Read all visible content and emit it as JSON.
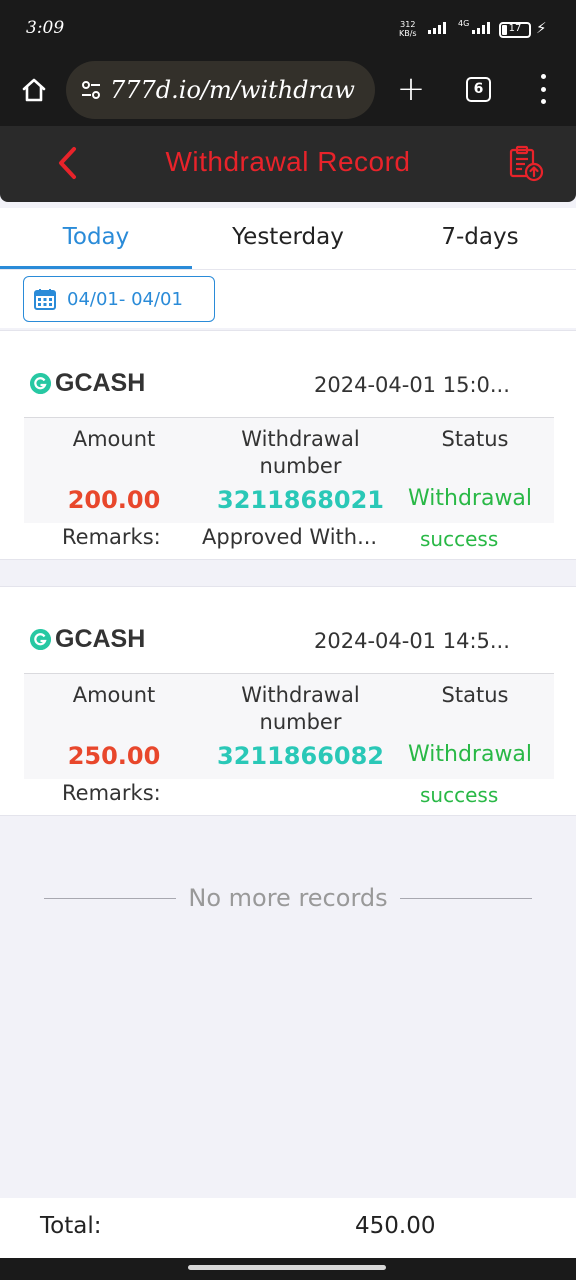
{
  "status_bar": {
    "time": "3:09",
    "net_speed": "312",
    "net_unit": "KB/s",
    "network_type": "4G",
    "battery": "17"
  },
  "browser": {
    "url": "777d.io/m/withdraw",
    "tab_count": "6",
    "new_tab_label": "+"
  },
  "header": {
    "title": "Withdrawal Record"
  },
  "tabs": [
    {
      "label": "Today",
      "active": true
    },
    {
      "label": "Yesterday",
      "active": false
    },
    {
      "label": "7-days",
      "active": false
    }
  ],
  "date_range": "04/01- 04/01",
  "columns": {
    "amount": "Amount",
    "number": "Withdrawal number",
    "status": "Status"
  },
  "remarks_label": "Remarks:",
  "records": [
    {
      "method": "GCASH",
      "time": "2024-04-01 15:0...",
      "amount": "200.00",
      "withdrawal_number": "3211868021",
      "status_line1": "Withdrawal",
      "status_line2": "success",
      "remarks": "Approved With..."
    },
    {
      "method": "GCASH",
      "time": "2024-04-01 14:5...",
      "amount": "250.00",
      "withdrawal_number": "3211866082",
      "status_line1": "Withdrawal",
      "status_line2": "success",
      "remarks": ""
    }
  ],
  "no_more": "No more records",
  "total": {
    "label": "Total:",
    "value": "450.00"
  },
  "colors": {
    "accent_blue": "#2a8bd8",
    "title_red": "#e8232a",
    "amount_red": "#e8472c",
    "number_teal": "#2ac8b7",
    "status_green": "#29b846",
    "gcash_logo": "#27c8a3"
  },
  "icons": {
    "home": "home-icon",
    "tune": "tune-icon",
    "back": "chevron-left-icon",
    "clipboard": "clipboard-upload-icon",
    "calendar": "calendar-icon",
    "gcash": "gcash-logo-icon"
  }
}
